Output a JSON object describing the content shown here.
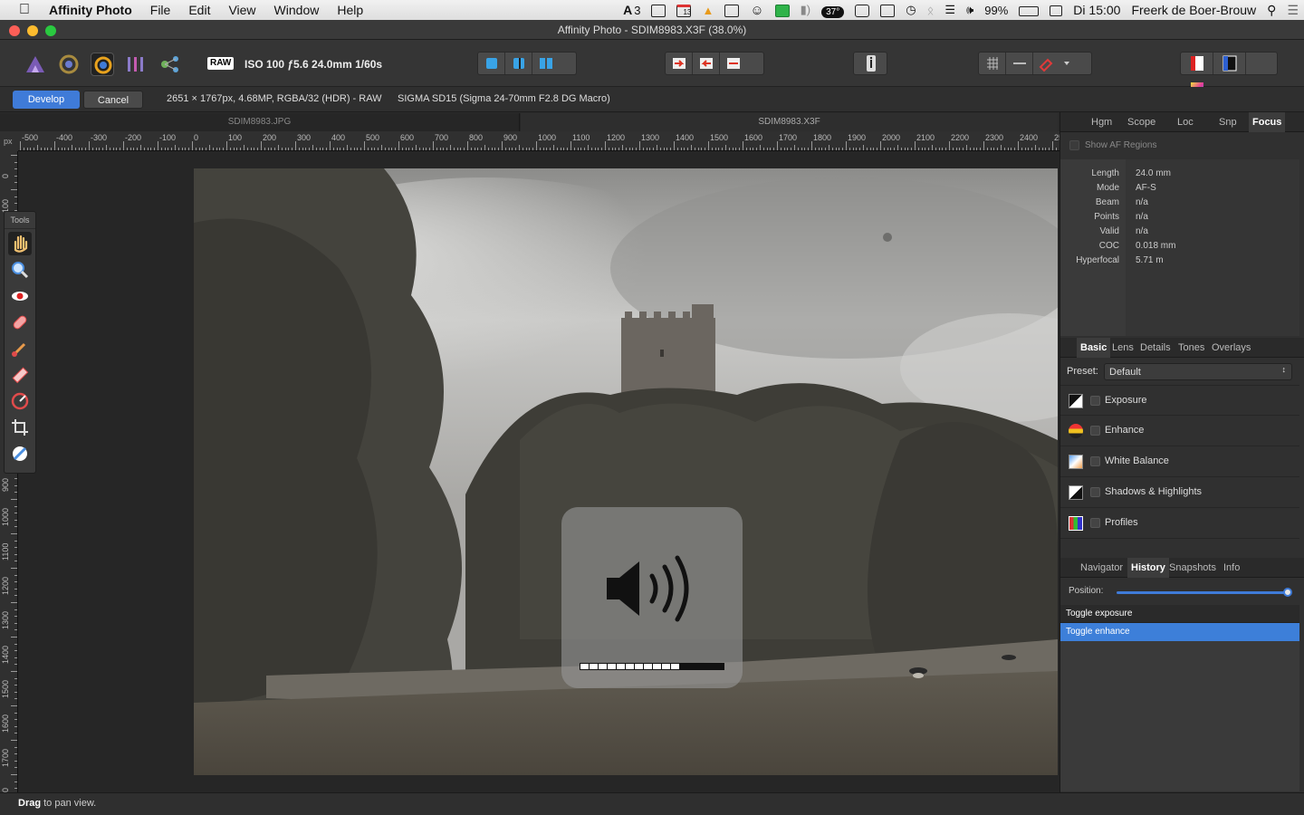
{
  "menubar": {
    "app_name": "Affinity Photo",
    "menus": [
      "File",
      "Edit",
      "View",
      "Window",
      "Help"
    ],
    "status_items": {
      "ai_badge": "3",
      "calendar_day": "13",
      "temperature": "37°",
      "battery": "99%",
      "datetime": "Di 15:00",
      "user": "Freerk de Boer-Brouw"
    }
  },
  "window": {
    "title": "Affinity Photo - SDIM8983.X3F (38.0%)"
  },
  "toolbar": {
    "raw_badge": "RAW",
    "exif": "ISO 100 ƒ5.6 24.0mm 1/60s"
  },
  "context": {
    "develop_label": "Develop",
    "cancel_label": "Cancel",
    "image_info": "2651 × 1767px, 4.68MP, RGBA/32 (HDR) - RAW",
    "lens_info": "SIGMA SD15 (Sigma 24-70mm F2.8 DG Macro)"
  },
  "doc_tabs": [
    "SDIM8983.JPG",
    "SDIM8983.X3F"
  ],
  "ruler": {
    "unit": "px",
    "h_labels": [
      "-500",
      "-400",
      "-300",
      "-200",
      "-100",
      "0",
      "100",
      "200",
      "300",
      "400",
      "500",
      "600",
      "700",
      "800",
      "900",
      "1000",
      "1100",
      "1200",
      "1300",
      "1400",
      "1500",
      "1600",
      "1700",
      "1800",
      "1900",
      "2000",
      "2100",
      "2200",
      "2300",
      "2400",
      "250"
    ],
    "v_labels": [
      "0",
      "100",
      "900",
      "1000",
      "1100",
      "1200",
      "1300",
      "1400",
      "1500",
      "1600",
      "1700",
      "800"
    ]
  },
  "tools": {
    "header": "Tools"
  },
  "focus_panel": {
    "tabs": [
      "Hgm",
      "Scope",
      "Loc",
      "Snp",
      "Focus"
    ],
    "active_tab": "Focus",
    "show_af_label": "Show AF Regions",
    "rows": [
      {
        "key": "Length",
        "value": "24.0 mm"
      },
      {
        "key": "Mode",
        "value": "AF-S"
      },
      {
        "key": "Beam",
        "value": "n/a"
      },
      {
        "key": "Points",
        "value": "n/a"
      },
      {
        "key": "Valid",
        "value": "n/a"
      },
      {
        "key": "COC",
        "value": "0.018 mm"
      },
      {
        "key": "Hyperfocal",
        "value": "5.71 m"
      }
    ]
  },
  "develop_panel": {
    "tabs": [
      "Basic",
      "Lens",
      "Details",
      "Tones",
      "Overlays"
    ],
    "active_tab": "Basic",
    "preset_label": "Preset:",
    "preset_value": "Default",
    "adjustments": [
      "Exposure",
      "Enhance",
      "White Balance",
      "Shadows & Highlights",
      "Profiles"
    ]
  },
  "history_panel": {
    "tabs": [
      "Navigator",
      "History",
      "Snapshots",
      "Info"
    ],
    "active_tab": "History",
    "position_label": "Position:",
    "position_value": 1.0,
    "items": [
      "Toggle exposure",
      "Toggle enhance"
    ],
    "selected_index": 1
  },
  "status": {
    "bold": "Drag",
    "text": " to pan view."
  },
  "volume_hud": {
    "level": 0.69,
    "segments": 16
  },
  "colors": {
    "accent": "#3f7bd8",
    "selected_row": "#3d7fd9"
  }
}
